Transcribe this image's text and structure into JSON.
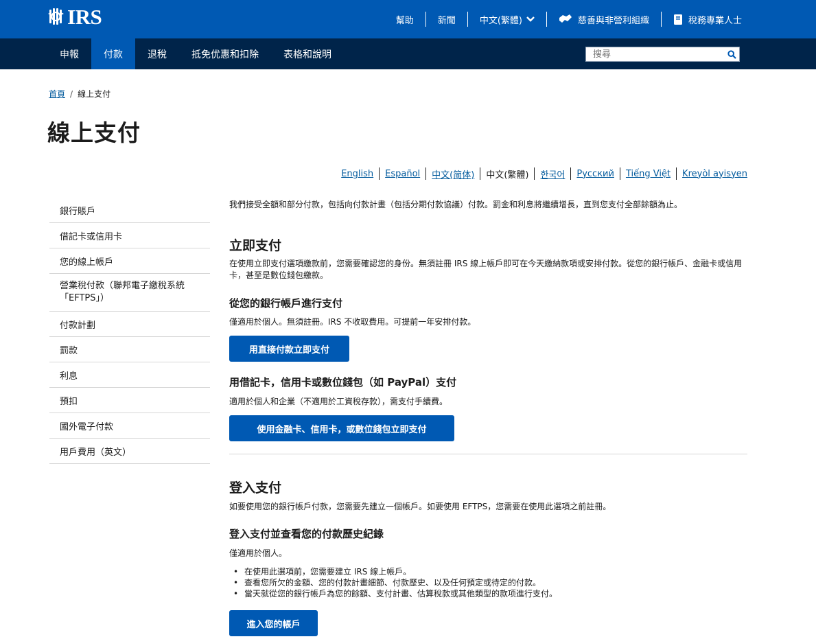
{
  "header": {
    "logo_text": "IRS",
    "util": {
      "help": "幫助",
      "news": "新聞",
      "language": "中文(繁體)",
      "charities": "慈善與非營利組織",
      "tax_pros": "稅務專業人士"
    }
  },
  "nav": {
    "items": [
      "申報",
      "付款",
      "退稅",
      "抵免优惠和扣除",
      "表格和說明"
    ],
    "active_index": 1,
    "search_placeholder": "搜尋"
  },
  "breadcrumb": {
    "home": "首頁",
    "separator": "/",
    "current": "線上支付"
  },
  "page_title": "線上支付",
  "languages": [
    {
      "label": "English"
    },
    {
      "label": "Español"
    },
    {
      "label": "中文(简体)"
    },
    {
      "label": "中文(繁體)",
      "current": true
    },
    {
      "label": "한국어"
    },
    {
      "label": "Русский"
    },
    {
      "label": "Tiếng Việt"
    },
    {
      "label": "Kreyòl ayisyen"
    }
  ],
  "sidebar": {
    "items": [
      "銀行賬戶",
      "借記卡或信用卡",
      "您的線上帳戶",
      "營業稅付款（聯邦電子繳稅系統「EFTPS」）",
      "付款計劃",
      "罰款",
      "利息",
      "預扣",
      "國外電子付款",
      "用戶費用（英文）"
    ]
  },
  "content": {
    "intro": "我們接受全額和部分付款，包括向付款計畫（包括分期付款協議）付款。罰金和利息將繼續增長，直到您支付全部餘額為止。",
    "pay_now_heading": "立即支付",
    "pay_now_text": "在使用立即支付選項繳款前，您需要確認您的身份。無須註冊 IRS 線上帳戶即可在今天繳納款項或安排付款。從您的銀行帳戶、金融卡或信用卡，甚至是數位錢包繳款。",
    "bank_heading": "從您的銀行帳戶進行支付",
    "bank_text": "僅適用於個人。無須註冊。IRS 不收取費用。可提前一年安排付款。",
    "bank_button": "用直接付款立即支付",
    "card_heading": "用借記卡，信用卡或數位錢包（如 PayPal）支付",
    "card_text": "適用於個人和企業（不適用於工資稅存款），需支付手續費。",
    "card_button": "使用金融卡、信用卡，或數位錢包立即支付",
    "signin_heading": "登入支付",
    "signin_text": "如要使用您的銀行帳戶付款，您需要先建立一個帳戶。如要使用 EFTPS，您需要在使用此選項之前註冊。",
    "history_heading": "登入支付並查看您的付款歷史紀錄",
    "history_text": "僅適用於個人。",
    "bullets": [
      "在使用此選項前，您需要建立 IRS 線上帳戶。",
      "查看您所欠的金額、您的付款計畫細節、付款歷史、以及任何預定或待定的付款。",
      "當天就從您的銀行帳戶為您的餘額、支付計畫、估算稅款或其他類型的款项進行支付。"
    ],
    "account_button": "進入您的帳戶"
  },
  "colors": {
    "header_blue": "#0059b3",
    "nav_navy": "#00244a",
    "link_blue": "#00599c"
  }
}
